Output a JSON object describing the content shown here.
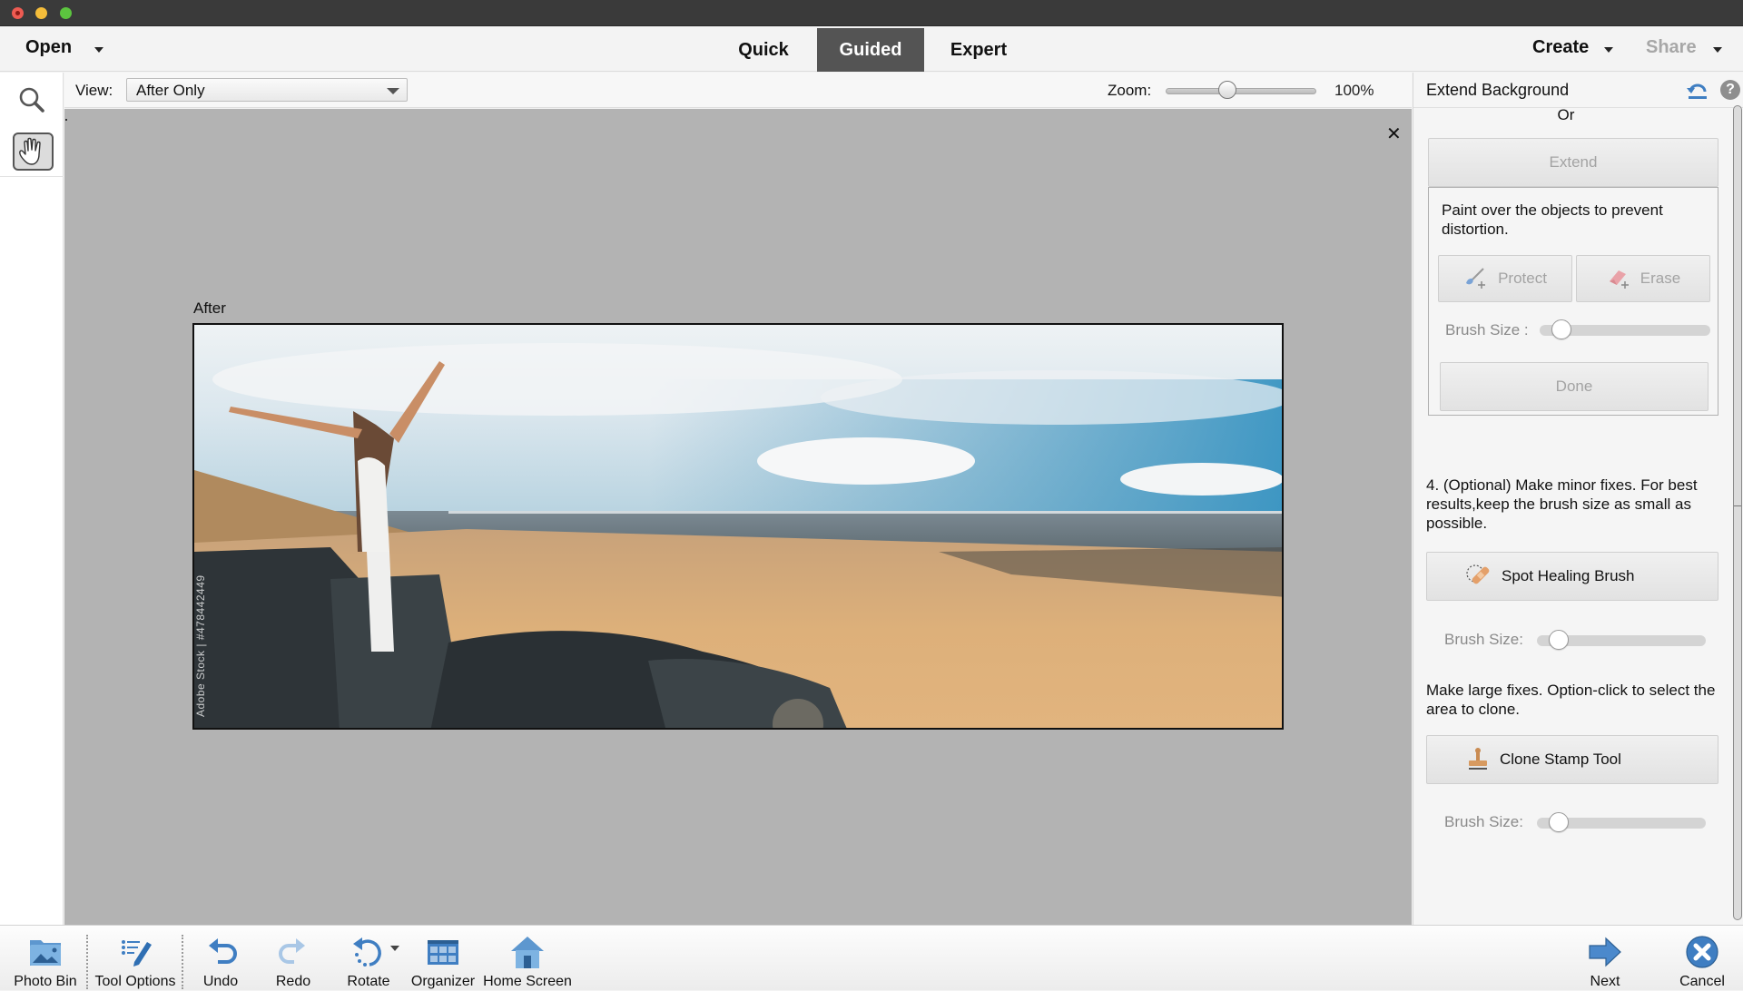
{
  "window": {
    "traffic_lights": [
      "close",
      "minimize",
      "zoom"
    ]
  },
  "modebar": {
    "open_label": "Open",
    "tabs": [
      {
        "label": "Quick",
        "active": false
      },
      {
        "label": "Guided",
        "active": true
      },
      {
        "label": "Expert",
        "active": false
      }
    ],
    "create_label": "Create",
    "share_label": "Share",
    "share_enabled": false
  },
  "toolbox": {
    "tools": [
      {
        "name": "zoom-tool",
        "icon": "magnifier-icon",
        "selected": false
      },
      {
        "name": "hand-tool",
        "icon": "hand-icon",
        "selected": true
      }
    ]
  },
  "viewbar": {
    "view_label": "View:",
    "view_selected": "After Only",
    "zoom_label": "Zoom:",
    "zoom_value": "100%",
    "zoom_slider_fraction": 0.4
  },
  "canvas": {
    "close_glyph": "✕",
    "after_label": "After",
    "watermark": "Adobe Stock | #478442449"
  },
  "panel": {
    "title": "Extend Background",
    "help_glyph": "?",
    "or_label": "Or",
    "extend_label": "Extend",
    "protect_description": "Paint over the objects to prevent distortion.",
    "protect_label": "Protect",
    "erase_label": "Erase",
    "brush_size_label_1": "Brush Size :",
    "brush_size_1_fraction": 0.08,
    "done_label": "Done",
    "step4_description": "4. (Optional) Make minor fixes. For best results,keep the brush size as small as possible.",
    "spot_healing_label": "Spot Healing Brush",
    "brush_size_label_2": "Brush Size:",
    "brush_size_2_fraction": 0.08,
    "large_fixes_description": "Make large fixes. Option-click to select the area to clone.",
    "clone_stamp_label": "Clone Stamp Tool",
    "brush_size_label_3": "Brush Size:",
    "brush_size_3_fraction": 0.08
  },
  "taskbar": {
    "left_items": [
      {
        "label": "Photo Bin",
        "icon": "photo-bin-icon"
      },
      {
        "label": "Tool Options",
        "icon": "tool-options-icon"
      },
      {
        "label": "Undo",
        "icon": "undo-icon"
      },
      {
        "label": "Redo",
        "icon": "redo-icon"
      },
      {
        "label": "Rotate",
        "icon": "rotate-icon"
      },
      {
        "label": "Organizer",
        "icon": "organizer-icon"
      },
      {
        "label": "Home Screen",
        "icon": "home-icon"
      }
    ],
    "next_label": "Next",
    "cancel_label": "Cancel"
  },
  "colors": {
    "accent_blue": "#3f7ec2",
    "active_tab_bg": "#545454",
    "canvas_bg": "#b3b3b3",
    "disabled_text": "#a3a3a3"
  }
}
